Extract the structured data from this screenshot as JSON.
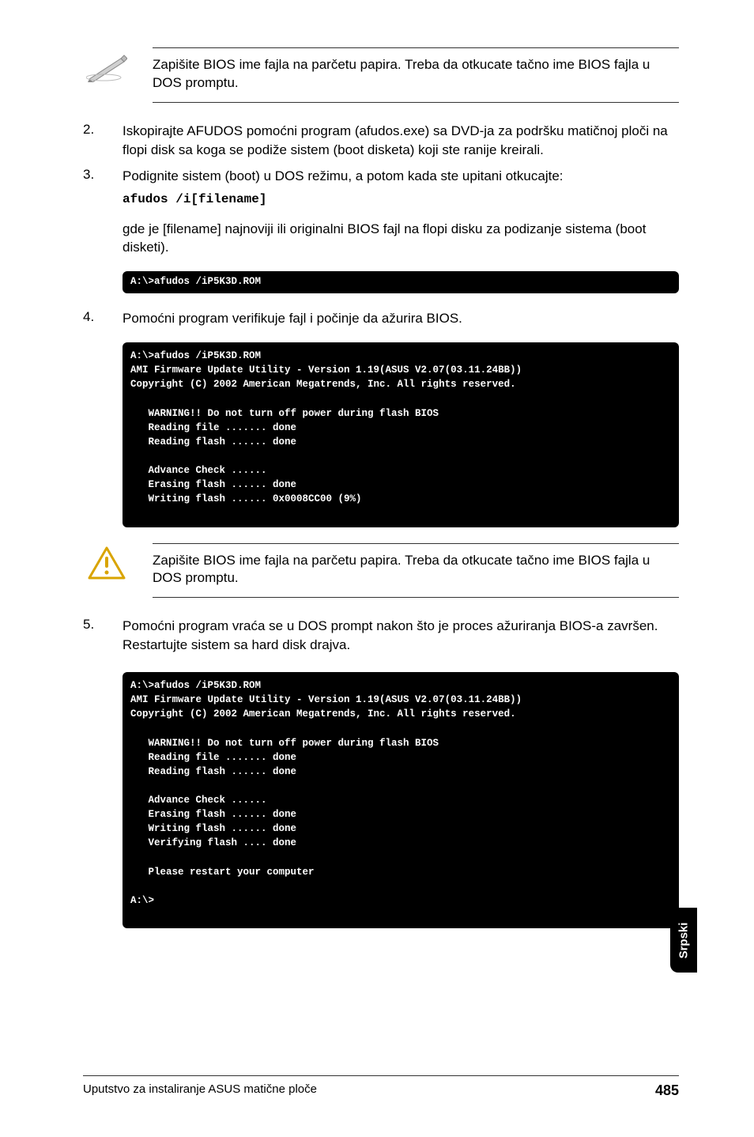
{
  "note1": "Zapišite BIOS ime fajla na parčetu papira. Treba da otkucate tačno ime BIOS fajla u DOS promptu.",
  "step2": {
    "num": "2.",
    "text": "Iskopirajte AFUDOS pomoćni program (afudos.exe) sa DVD-ja za podršku matičnoj ploči na flopi disk sa koga se podiže sistem (boot disketa) koji ste ranije kreirali."
  },
  "step3": {
    "num": "3.",
    "text": "Podignite sistem (boot) u DOS režimu, a potom kada ste upitani otkucajte:",
    "cmd": "afudos /i[filename]"
  },
  "step3_para": "gde je [filename] najnoviji ili originalni BIOS fajl na flopi disku za podizanje sistema (boot disketi).",
  "term1": "A:\\>afudos /iP5K3D.ROM",
  "step4": {
    "num": "4.",
    "text": "Pomoćni program verifikuje fajl i počinje da ažurira BIOS."
  },
  "term2": "A:\\>afudos /iP5K3D.ROM\nAMI Firmware Update Utility - Version 1.19(ASUS V2.07(03.11.24BB))\nCopyright (C) 2002 American Megatrends, Inc. All rights reserved.\n\n   WARNING!! Do not turn off power during flash BIOS\n   Reading file ....... done\n   Reading flash ...... done\n\n   Advance Check ......\n   Erasing flash ...... done\n   Writing flash ...... 0x0008CC00 (9%)",
  "note2": "Zapišite BIOS ime fajla na parčetu papira. Treba da otkucate tačno ime BIOS fajla u DOS promptu.",
  "step5": {
    "num": "5.",
    "text": "Pomoćni program vraća se u DOS prompt nakon što je proces ažuriranja BIOS-a završen.  Restartujte sistem sa hard disk drajva."
  },
  "term3": "A:\\>afudos /iP5K3D.ROM\nAMI Firmware Update Utility - Version 1.19(ASUS V2.07(03.11.24BB))\nCopyright (C) 2002 American Megatrends, Inc. All rights reserved.\n\n   WARNING!! Do not turn off power during flash BIOS\n   Reading file ....... done\n   Reading flash ...... done\n\n   Advance Check ......\n   Erasing flash ...... done\n   Writing flash ...... done\n   Verifying flash .... done\n\n   Please restart your computer\n\nA:\\>",
  "side_tab": "Srpski",
  "footer_left": "Uputstvo za instaliranje ASUS matične ploče",
  "footer_right": "485"
}
